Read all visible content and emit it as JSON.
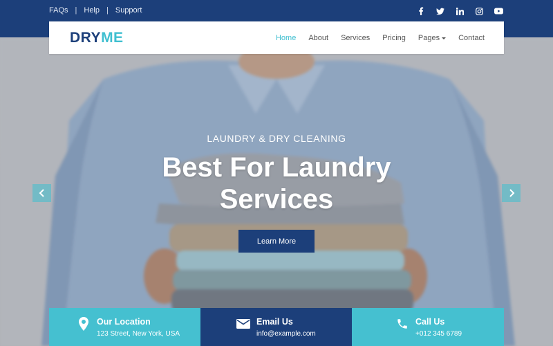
{
  "topbar": {
    "links": [
      "FAQs",
      "Help",
      "Support"
    ],
    "social_icons": [
      "facebook-icon",
      "twitter-icon",
      "linkedin-icon",
      "instagram-icon",
      "youtube-icon"
    ]
  },
  "brand": {
    "part1": "DRY",
    "part2": "ME"
  },
  "nav": {
    "items": [
      "Home",
      "About",
      "Services",
      "Pricing",
      "Pages",
      "Contact"
    ],
    "active": "Home"
  },
  "hero": {
    "kicker": "LAUNDRY & DRY CLEANING",
    "title_line1": "Best For Laundry",
    "title_line2": "Services",
    "cta": "Learn More"
  },
  "info": {
    "location": {
      "title": "Our Location",
      "detail": "123 Street, New York, USA"
    },
    "email": {
      "title": "Email Us",
      "detail": "info@example.com"
    },
    "phone": {
      "title": "Call Us",
      "detail": "+012 345 6789"
    }
  },
  "colors": {
    "primary": "#1c3f7a",
    "accent": "#3fbfd0"
  }
}
